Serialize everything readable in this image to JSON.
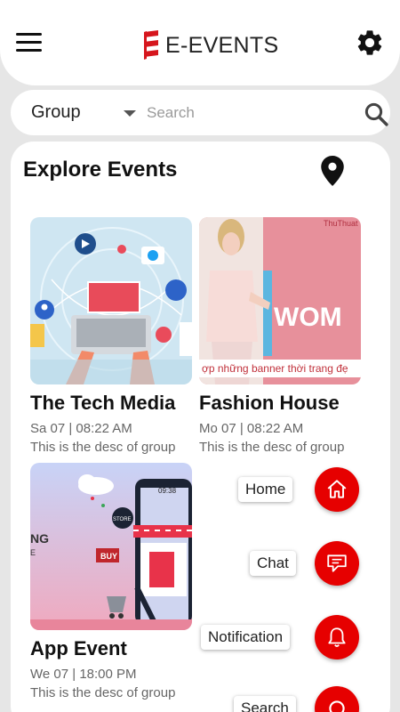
{
  "header": {
    "app_title": "E-EVENTS",
    "brand_color": "#d6161d",
    "icons": [
      "menu-icon",
      "gear-icon"
    ]
  },
  "filter": {
    "group_label": "Group",
    "search_placeholder": "Search",
    "search_value": ""
  },
  "main": {
    "title": "Explore Events",
    "location_icon": "map-pin-icon",
    "events": [
      {
        "title": "The Tech Media",
        "date": "Sa 07 | 08:22 AM",
        "desc": "This is the desc of group"
      },
      {
        "title": "Fashion House",
        "date": "Mo 07 | 08:22 AM",
        "desc": "This is the desc of group",
        "banner_text": "WOM",
        "banner_caption": "ợp những banner thời trang đẹ",
        "watermark": "ThuThuat"
      },
      {
        "title": "App Event",
        "date": "We 07 | 18:00 PM",
        "desc": "This is the desc of group",
        "image_text": {
          "left_text": "NG",
          "left_sub": "E",
          "buy": "BUY",
          "store": "STORE",
          "clock": "09:38"
        }
      }
    ]
  },
  "fab_menu": {
    "accent_color": "#e60000",
    "items": [
      {
        "label": "Home",
        "icon": "home-icon"
      },
      {
        "label": "Chat",
        "icon": "chat-icon"
      },
      {
        "label": "Notification",
        "icon": "bell-icon"
      },
      {
        "label": "Search",
        "icon": "search-icon"
      }
    ]
  }
}
